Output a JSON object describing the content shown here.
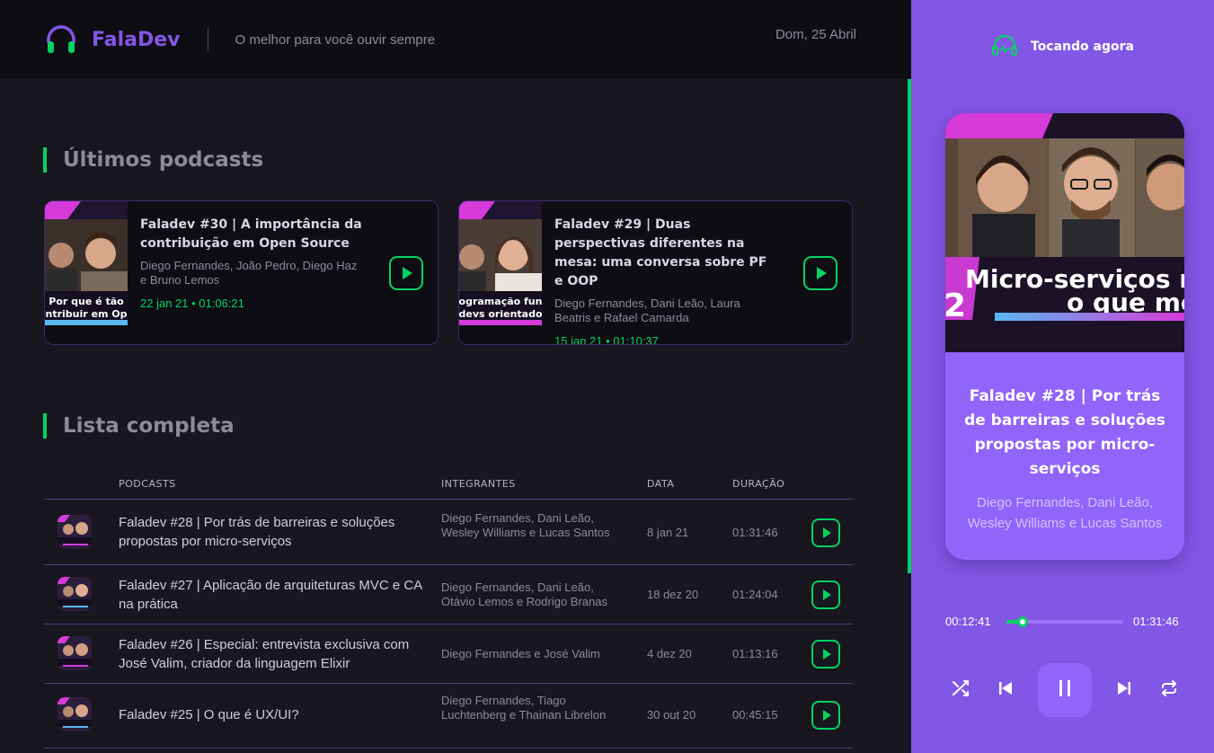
{
  "header": {
    "brand": "FalaDev",
    "tagline": "O melhor para você ouvir sempre",
    "date": "Dom, 25 Abril"
  },
  "latest": {
    "title": "Últimos podcasts",
    "cards": [
      {
        "title": "Faladev #30 | A importância da contribuição em Open Source",
        "members": "Diego Fernandes, João Pedro, Diego Haz e Bruno Lemos",
        "date": "22 jan 21",
        "duration": "01:06:21",
        "thumb_text": [
          "Por que é tão",
          "ntribuir em Op"
        ]
      },
      {
        "title": "Faladev #29 | Duas perspectivas diferentes na mesa: uma conversa sobre PF e OOP",
        "members": "Diego Fernandes, Dani Leão, Laura Beatris e Rafael Camarda",
        "date": "15 jan 21",
        "duration": "01:10:37",
        "thumb_text": [
          "ogramação fun",
          "devs orientado"
        ]
      }
    ]
  },
  "full_list": {
    "title": "Lista completa",
    "columns": [
      "PODCASTS",
      "INTEGRANTES",
      "DATA",
      "DURAÇÃO"
    ],
    "rows": [
      {
        "title": "Faladev #28 | Por trás de barreiras e soluções propostas por micro-serviços",
        "members": "Diego Fernandes, Dani Leão, Wesley Williams e Lucas Santos",
        "date": "8 jan 21",
        "duration": "01:31:46"
      },
      {
        "title": "Faladev #27 | Aplicação de arquiteturas MVC e CA na prática",
        "members": "Diego Fernandes, Dani Leão, Otávio Lemos e Rodrigo Branas",
        "date": "18 dez 20",
        "duration": "01:24:04"
      },
      {
        "title": "Faladev #26 | Especial: entrevista exclusiva com José Valim, criador da linguagem Elixir",
        "members": "Diego Fernandes e José Valim",
        "date": "4 dez 20",
        "duration": "01:13:16"
      },
      {
        "title": "Faladev #25 | O que é UX/UI?",
        "members": "Diego Fernandes, Tiago Luchtenberg e Thainan Librelon",
        "date": "30 out 20",
        "duration": "00:45:15"
      }
    ]
  },
  "player": {
    "label": "Tocando agora",
    "thumb_text": [
      "Micro-serviços re",
      "o que me",
      "2"
    ],
    "title": "Faladev #28 | Por trás de barreiras e soluções propostas por micro-serviços",
    "members": "Diego Fernandes, Dani Leão, Wesley Williams e Lucas Santos",
    "current_time": "00:12:41",
    "total_time": "01:31:46",
    "progress": 0.14
  },
  "colors": {
    "accent": "#8257e5",
    "green": "#04d361",
    "background": "#18161f"
  }
}
